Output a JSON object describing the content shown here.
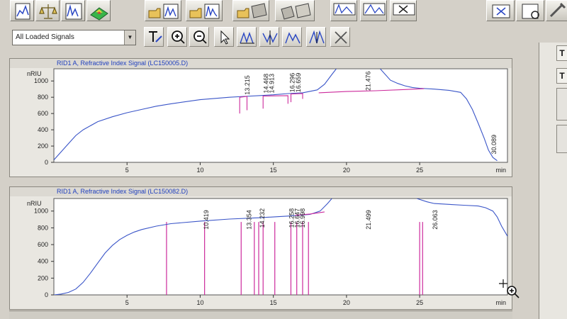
{
  "toolbar": {
    "icons": [
      "data-analysis-icon",
      "calibration-scale-icon",
      "chromatogram-icon",
      "spectrum-3d-icon",
      "load-signal-icon",
      "load-multi-signal-icon",
      "open-method-icon",
      "save-method-icon",
      "integrate-icon",
      "peak-view-icon",
      "close-window-icon",
      "print-icon",
      "report-icon",
      "tools-icon"
    ]
  },
  "signal_selector": {
    "value": "All Loaded Signals"
  },
  "tools": {
    "icons": [
      "text-tool-icon",
      "zoom-in-icon",
      "zoom-out-icon",
      "select-pointer-icon",
      "peak-baseline-icon",
      "peak-drop-icon",
      "peak-tangent-icon",
      "peak-split-icon",
      "delete-peak-icon"
    ]
  },
  "side_buttons": [
    "T",
    "T"
  ],
  "colors": {
    "trace": "#3a55c8",
    "baseline": "#cc2a9c",
    "title": "#1f3fbf",
    "plot_bg": "#ffffff"
  },
  "chart_data": [
    {
      "type": "line",
      "title": "RID1 A, Refractive Index Signal (LC150005.D)",
      "xlabel": "min",
      "ylabel": "nRIU",
      "xlim": [
        0,
        31
      ],
      "ylim": [
        0,
        1150
      ],
      "xticks": [
        "5",
        "10",
        "15",
        "20",
        "25"
      ],
      "yticks": [
        "0",
        "200",
        "400",
        "600",
        "800",
        "1000"
      ],
      "peak_labels": [
        "13.215",
        "14.468",
        "14.913",
        "16.296",
        "16.659",
        "21.476",
        "30.089"
      ],
      "peak_times": [
        13.215,
        14.468,
        14.913,
        16.296,
        16.659,
        21.476,
        30.089
      ],
      "series": [
        {
          "x": [
            0,
            0.5,
            1,
            1.5,
            2,
            3,
            4,
            5,
            6,
            7,
            8,
            10,
            12,
            13,
            14,
            15,
            16,
            17,
            18,
            18.5,
            19,
            19.3
          ],
          "y": [
            30,
            130,
            230,
            330,
            400,
            500,
            560,
            610,
            650,
            690,
            720,
            770,
            800,
            810,
            820,
            830,
            845,
            855,
            890,
            960,
            1080,
            1150
          ]
        },
        {
          "x": [
            22.3,
            23,
            23.5,
            24,
            24.5,
            25,
            26,
            27,
            27.8,
            28.2,
            28.6,
            29,
            29.4,
            29.7,
            30,
            30.3
          ],
          "y": [
            1150,
            1010,
            970,
            940,
            920,
            910,
            900,
            885,
            860,
            780,
            650,
            480,
            300,
            150,
            60,
            20
          ]
        },
        {
          "x": [
            18.1,
            20,
            22,
            24,
            25.3
          ],
          "y": [
            855,
            870,
            880,
            895,
            905
          ]
        },
        {
          "x": [
            12.7,
            12.7,
            13.2,
            13.2
          ],
          "y": [
            600,
            800,
            810,
            640
          ]
        },
        {
          "x": [
            14.3,
            14.3,
            16.0,
            16.0
          ],
          "y": [
            660,
            815,
            820,
            720
          ]
        },
        {
          "x": [
            16.2,
            16.2,
            17.0,
            17.0
          ],
          "y": [
            740,
            840,
            845,
            780
          ]
        }
      ]
    },
    {
      "type": "line",
      "title": "RID1 A, Refractive Index Signal (LC150082.D)",
      "xlabel": "min",
      "ylabel": "nRIU",
      "xlim": [
        0,
        31
      ],
      "ylim": [
        0,
        1150
      ],
      "xticks": [
        "5",
        "10",
        "15",
        "20",
        "25"
      ],
      "yticks": [
        "0",
        "200",
        "400",
        "600",
        "800",
        "1000"
      ],
      "peak_labels": [
        "10.419",
        "13.354",
        "14.232",
        "16.258",
        "16.647",
        "16.998",
        "21.499",
        "26.063"
      ],
      "peak_times": [
        7.7,
        10.3,
        12.8,
        13.7,
        14.0,
        14.3,
        15.1,
        16.2,
        16.6,
        17.0,
        17.4,
        25.0,
        25.2
      ],
      "series": [
        {
          "x": [
            0,
            0.5,
            1,
            1.5,
            2,
            2.5,
            3,
            3.5,
            4,
            4.5,
            5,
            5.5,
            6,
            7,
            8,
            10,
            12,
            14,
            16,
            17.5,
            18.2,
            18.7,
            19.0
          ],
          "y": [
            0,
            10,
            30,
            70,
            150,
            260,
            380,
            500,
            590,
            660,
            710,
            750,
            780,
            820,
            850,
            880,
            905,
            920,
            940,
            960,
            1000,
            1090,
            1150
          ]
        },
        {
          "x": [
            24.8,
            25.5,
            26,
            27,
            28,
            29,
            29.5,
            30,
            30.3,
            30.6,
            31
          ],
          "y": [
            1150,
            1110,
            1090,
            1080,
            1070,
            1060,
            1040,
            1000,
            930,
            820,
            700
          ]
        },
        {
          "x": [
            16.5,
            17.5,
            18.5
          ],
          "y": [
            950,
            965,
            990
          ]
        }
      ]
    }
  ]
}
